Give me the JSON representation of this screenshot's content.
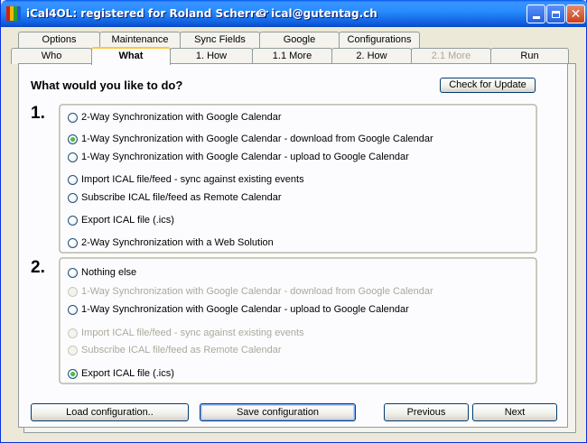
{
  "window": {
    "title": "iCal4OL: registered for Roland Scherrer",
    "email": "© ical@gutentag.ch",
    "icon": "ical4ol-app-icon",
    "colors": {
      "titlebar": "#0a49c4",
      "accent": "#ffc83c"
    }
  },
  "tabs_row1": [
    {
      "label": "Options"
    },
    {
      "label": "Maintenance"
    },
    {
      "label": "Sync Fields"
    },
    {
      "label": "Google"
    },
    {
      "label": "Configurations"
    }
  ],
  "tabs_row2": [
    {
      "label": "Who"
    },
    {
      "label": "What",
      "selected": true
    },
    {
      "label": "1. How"
    },
    {
      "label": "1.1 More"
    },
    {
      "label": "2. How"
    },
    {
      "label": "2.1 More",
      "disabled": true
    },
    {
      "label": "Run"
    }
  ],
  "main": {
    "heading": "What would you like to do?",
    "check_update_label": "Check for Update",
    "step1": {
      "number": "1.",
      "options": [
        {
          "label": "2-Way Synchronization with Google Calendar",
          "checked": false,
          "disabled": false
        },
        {
          "label": "1-Way Synchronization with Google Calendar - download from Google Calendar",
          "checked": true,
          "disabled": false
        },
        {
          "label": "1-Way Synchronization with Google Calendar - upload to Google Calendar",
          "checked": false,
          "disabled": false
        },
        {
          "label": "Import ICAL file/feed - sync against existing events",
          "checked": false,
          "disabled": false
        },
        {
          "label": "Subscribe ICAL file/feed as Remote Calendar",
          "checked": false,
          "disabled": false
        },
        {
          "label": "Export ICAL file (.ics)",
          "checked": false,
          "disabled": false
        },
        {
          "label": "2-Way Synchronization with a Web Solution",
          "checked": false,
          "disabled": false
        }
      ]
    },
    "step2": {
      "number": "2.",
      "options": [
        {
          "label": "Nothing else",
          "checked": false,
          "disabled": false
        },
        {
          "label": "1-Way Synchronization with Google Calendar - download from Google Calendar",
          "checked": false,
          "disabled": true
        },
        {
          "label": "1-Way Synchronization with Google Calendar - upload to Google Calendar",
          "checked": false,
          "disabled": false
        },
        {
          "label": "Import ICAL file/feed - sync against existing events",
          "checked": false,
          "disabled": true
        },
        {
          "label": "Subscribe ICAL file/feed as Remote Calendar",
          "checked": false,
          "disabled": true
        },
        {
          "label": "Export ICAL file (.ics)",
          "checked": true,
          "disabled": false
        }
      ]
    }
  },
  "footer": {
    "load_label": "Load configuration..",
    "save_label": "Save configuration",
    "previous_label": "Previous",
    "next_label": "Next"
  }
}
